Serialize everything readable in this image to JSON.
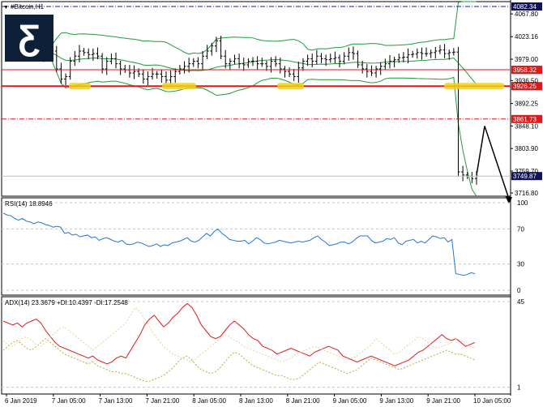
{
  "window": {
    "symbol_label": "#Bitcoin,H1"
  },
  "chart_data": [
    {
      "type": "candlestick",
      "name": "#Bitcoin,H1",
      "ylim": [
        3716.8,
        4082.34
      ],
      "y_ticks": [
        {
          "value": 4067.8,
          "label": "4067.80"
        },
        {
          "value": 4023.16,
          "label": "4023.16"
        },
        {
          "value": 3979.0,
          "label": "3979.00"
        },
        {
          "value": 3937.18,
          "label": "3936.50"
        },
        {
          "value": 3892.25,
          "label": "3892.25"
        },
        {
          "value": 3848.1,
          "label": "3848.10"
        },
        {
          "value": 3803.9,
          "label": "3803.90"
        },
        {
          "value": 3759.7,
          "label": "3759.70"
        },
        {
          "value": 3716.8,
          "label": "3716.80"
        }
      ],
      "levels": [
        {
          "name": "top",
          "value": 4082.34,
          "label": "4082.34",
          "style": "dash-dot",
          "color": "#1b1b9c"
        },
        {
          "name": "resistance",
          "value": 3958.32,
          "label": "3958.32",
          "style": "solid",
          "color": "#e01818"
        },
        {
          "name": "support",
          "value": 3926.25,
          "label": "3926.25",
          "style": "solid-thick",
          "color": "#e01818"
        },
        {
          "name": "target",
          "value": 3861.73,
          "label": "3861.73",
          "style": "dash-dot",
          "color": "#e01818"
        },
        {
          "name": "bid",
          "value": 3749.87,
          "label": "3749.87",
          "style": "solid",
          "color": "#c0c0c0"
        }
      ],
      "closes": [
        3995,
        3990,
        3992,
        3985,
        3990,
        3995,
        3960,
        3940,
        3945,
        3975,
        3985,
        3995,
        3992,
        3988,
        3990,
        3985,
        3960,
        3975,
        3980,
        3970,
        3960,
        3958,
        3952,
        3955,
        3950,
        3940,
        3945,
        3950,
        3950,
        3945,
        3938,
        3945,
        3955,
        3960,
        3965,
        3970,
        3975,
        3970,
        3985,
        3995,
        4005,
        4015,
        3985,
        3970,
        3975,
        3980,
        3970,
        3968,
        3975,
        3975,
        3970,
        3970,
        3965,
        3975,
        3970,
        3960,
        3955,
        3950,
        3945,
        3962,
        3975,
        3980,
        3975,
        3985,
        3980,
        3978,
        3980,
        3982,
        3975,
        3985,
        3992,
        3990,
        3968,
        3960,
        3955,
        3952,
        3960,
        3965,
        3970,
        3975,
        3978,
        3982,
        3983,
        3988,
        3989,
        3992,
        3990,
        3990,
        3992,
        3995,
        3997,
        3990,
        3992,
        3993,
        3758,
        3752,
        3750,
        3745,
        3750
      ],
      "bollinger": {
        "period": 20,
        "color": "#1f9b3a"
      },
      "x_ticks": [
        "6 Jan 2019",
        "7 Jan 05:00",
        "7 Jan 13:00",
        "7 Jan 21:00",
        "8 Jan 05:00",
        "8 Jan 13:00",
        "8 Jan 21:00",
        "9 Jan 05:00",
        "9 Jan 13:00",
        "9 Jan 21:00",
        "10 Jan 05:00"
      ]
    },
    {
      "type": "line",
      "name": "RSI(14)",
      "header": "RSI(14) 18.8946",
      "ylim": [
        0,
        100
      ],
      "y_ticks": [
        {
          "value": 100,
          "label": "100"
        },
        {
          "value": 70,
          "label": "70"
        },
        {
          "value": 30,
          "label": "30"
        },
        {
          "value": 0,
          "label": "0"
        }
      ],
      "series": [
        {
          "color": "#1e78d6",
          "values": [
            88,
            86,
            85,
            82,
            80,
            82,
            79,
            78,
            76,
            78,
            77,
            75,
            74,
            72,
            73,
            72,
            65,
            66,
            63,
            64,
            61,
            62,
            63,
            60,
            61,
            57,
            59,
            60,
            58,
            56,
            55,
            57,
            53,
            52,
            53,
            55,
            54,
            52,
            50,
            51,
            53,
            50,
            52,
            51,
            54,
            55,
            56,
            58,
            60,
            56,
            55,
            57,
            61,
            65,
            62,
            67,
            70,
            65,
            62,
            58,
            57,
            56,
            56,
            57,
            53,
            56,
            60,
            58,
            54,
            53,
            54,
            55,
            57,
            56,
            55,
            54,
            55,
            56,
            55,
            56,
            57,
            60,
            62,
            58,
            55,
            51,
            52,
            53,
            55,
            55,
            53,
            55,
            59,
            62,
            62,
            62,
            57,
            54,
            55,
            56,
            59,
            58,
            60,
            54,
            52,
            56,
            57,
            58,
            54,
            56,
            54,
            58,
            62,
            61,
            59,
            60,
            55,
            58,
            19,
            18,
            17,
            18,
            20,
            19
          ]
        }
      ]
    },
    {
      "type": "line",
      "name": "ADX(14)",
      "header": "ADX(14) 23.3679 +DI:10.4397 -DI:17.2548",
      "ylim": [
        0,
        45
      ],
      "y_ticks": [
        {
          "value": 45,
          "label": "45"
        },
        {
          "value": 1,
          "label": "1"
        }
      ],
      "series": [
        {
          "color": "#e01818",
          "values": [
            35,
            34,
            33,
            34,
            32,
            34,
            35,
            36,
            34,
            30,
            27,
            24,
            22,
            21,
            20,
            19,
            18,
            17,
            16,
            17,
            15,
            14,
            13,
            14,
            16,
            17,
            16,
            20,
            24,
            28,
            33,
            36,
            38,
            35,
            32,
            34,
            37,
            39,
            42,
            44,
            42,
            38,
            33,
            30,
            27,
            26,
            27,
            30,
            33,
            35,
            33,
            31,
            28,
            26,
            25,
            22,
            21,
            20,
            18,
            19,
            20,
            21,
            20,
            19,
            18,
            17,
            19,
            20,
            21,
            22,
            21,
            20,
            17,
            16,
            15,
            14,
            15,
            16,
            17,
            16,
            15,
            14,
            13,
            12,
            13,
            14,
            15,
            17,
            19,
            20,
            22,
            24,
            26,
            28,
            26,
            25,
            26,
            24,
            22,
            23,
            24
          ]
        },
        {
          "color": "#aab23a",
          "values": [
            20,
            22,
            24,
            25,
            23,
            21,
            20,
            22,
            24,
            26,
            24,
            22,
            20,
            18,
            17,
            16,
            15,
            14,
            13,
            14,
            12,
            11,
            10,
            9,
            9,
            8,
            8,
            7,
            6,
            5,
            4,
            4,
            5,
            6,
            7,
            9,
            11,
            14,
            16,
            17,
            15,
            12,
            10,
            9,
            8,
            9,
            11,
            14,
            17,
            19,
            18,
            16,
            14,
            12,
            11,
            10,
            9,
            8,
            7,
            7,
            6,
            5,
            5,
            6,
            8,
            10,
            12,
            14,
            13,
            12,
            11,
            10,
            9,
            8,
            9,
            10,
            12,
            14,
            16,
            15,
            14,
            13,
            12,
            11,
            10,
            11,
            12,
            13,
            14,
            15,
            16,
            17,
            18,
            19,
            20,
            19,
            18,
            18,
            17,
            16,
            15
          ]
        },
        {
          "color": "#e7d49a",
          "values": [
            25,
            23,
            22,
            24,
            26,
            27,
            25,
            23,
            22,
            24,
            27,
            29,
            31,
            32,
            30,
            28,
            26,
            24,
            22,
            20,
            22,
            24,
            26,
            28,
            30,
            32,
            34,
            38,
            42,
            40,
            36,
            32,
            28,
            25,
            22,
            20,
            18,
            17,
            16,
            15,
            14,
            16,
            18,
            20,
            22,
            24,
            26,
            28,
            27,
            25,
            24,
            22,
            21,
            20,
            19,
            18,
            17,
            16,
            15,
            14,
            15,
            16,
            18,
            19,
            20,
            21,
            22,
            21,
            20,
            19,
            18,
            17,
            16,
            15,
            16,
            17,
            19,
            21,
            23,
            26,
            24,
            22,
            20,
            18,
            19,
            21,
            23,
            25,
            27,
            26,
            24,
            22,
            21,
            22,
            23,
            24,
            26,
            25,
            23,
            22,
            21
          ]
        }
      ]
    }
  ],
  "watermark": {
    "letter": "Ƹ",
    "bg": "#0e2038"
  }
}
